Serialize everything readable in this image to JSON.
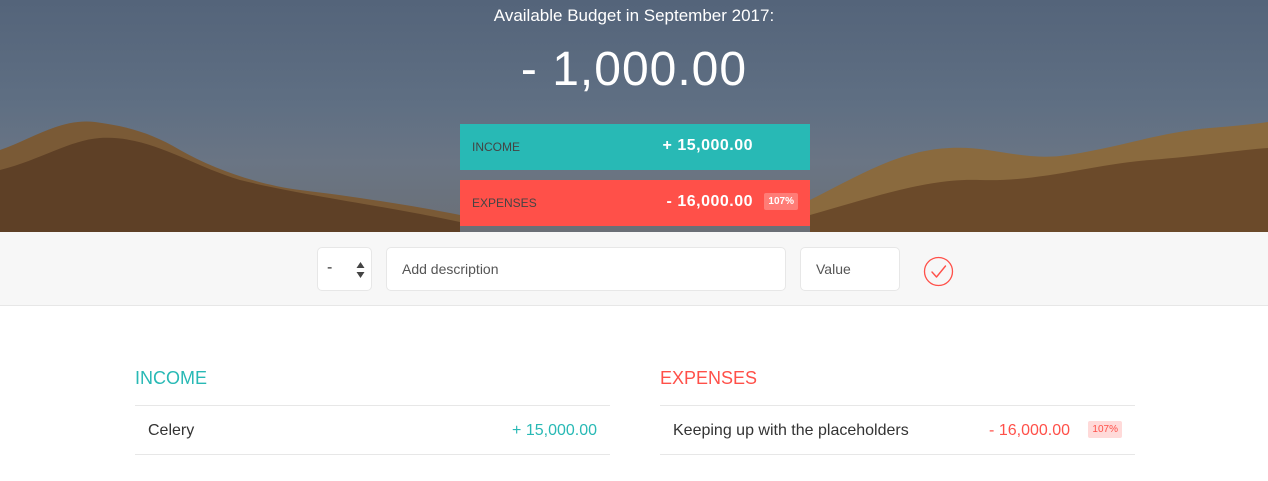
{
  "header": {
    "title": "Available Budget in September 2017:",
    "budget_value": "- 1,000.00"
  },
  "summary": {
    "income_label": "Income",
    "income_value": "+ 15,000.00",
    "expenses_label": "Expenses",
    "expenses_value": "- 16,000.00",
    "expenses_percentage": "107%"
  },
  "add_form": {
    "type_value": "-",
    "description_placeholder": "Add description",
    "value_placeholder": "Value",
    "submit_icon": "check-circle-icon"
  },
  "income_list": {
    "title": "Income",
    "items": [
      {
        "description": "Celery",
        "value": "+ 15,000.00"
      }
    ]
  },
  "expenses_list": {
    "title": "Expenses",
    "items": [
      {
        "description": "Keeping up with the placeholders",
        "value": "- 16,000.00",
        "percentage": "107%"
      }
    ]
  },
  "colors": {
    "income": "#28b9b5",
    "expenses": "#ff5049"
  }
}
